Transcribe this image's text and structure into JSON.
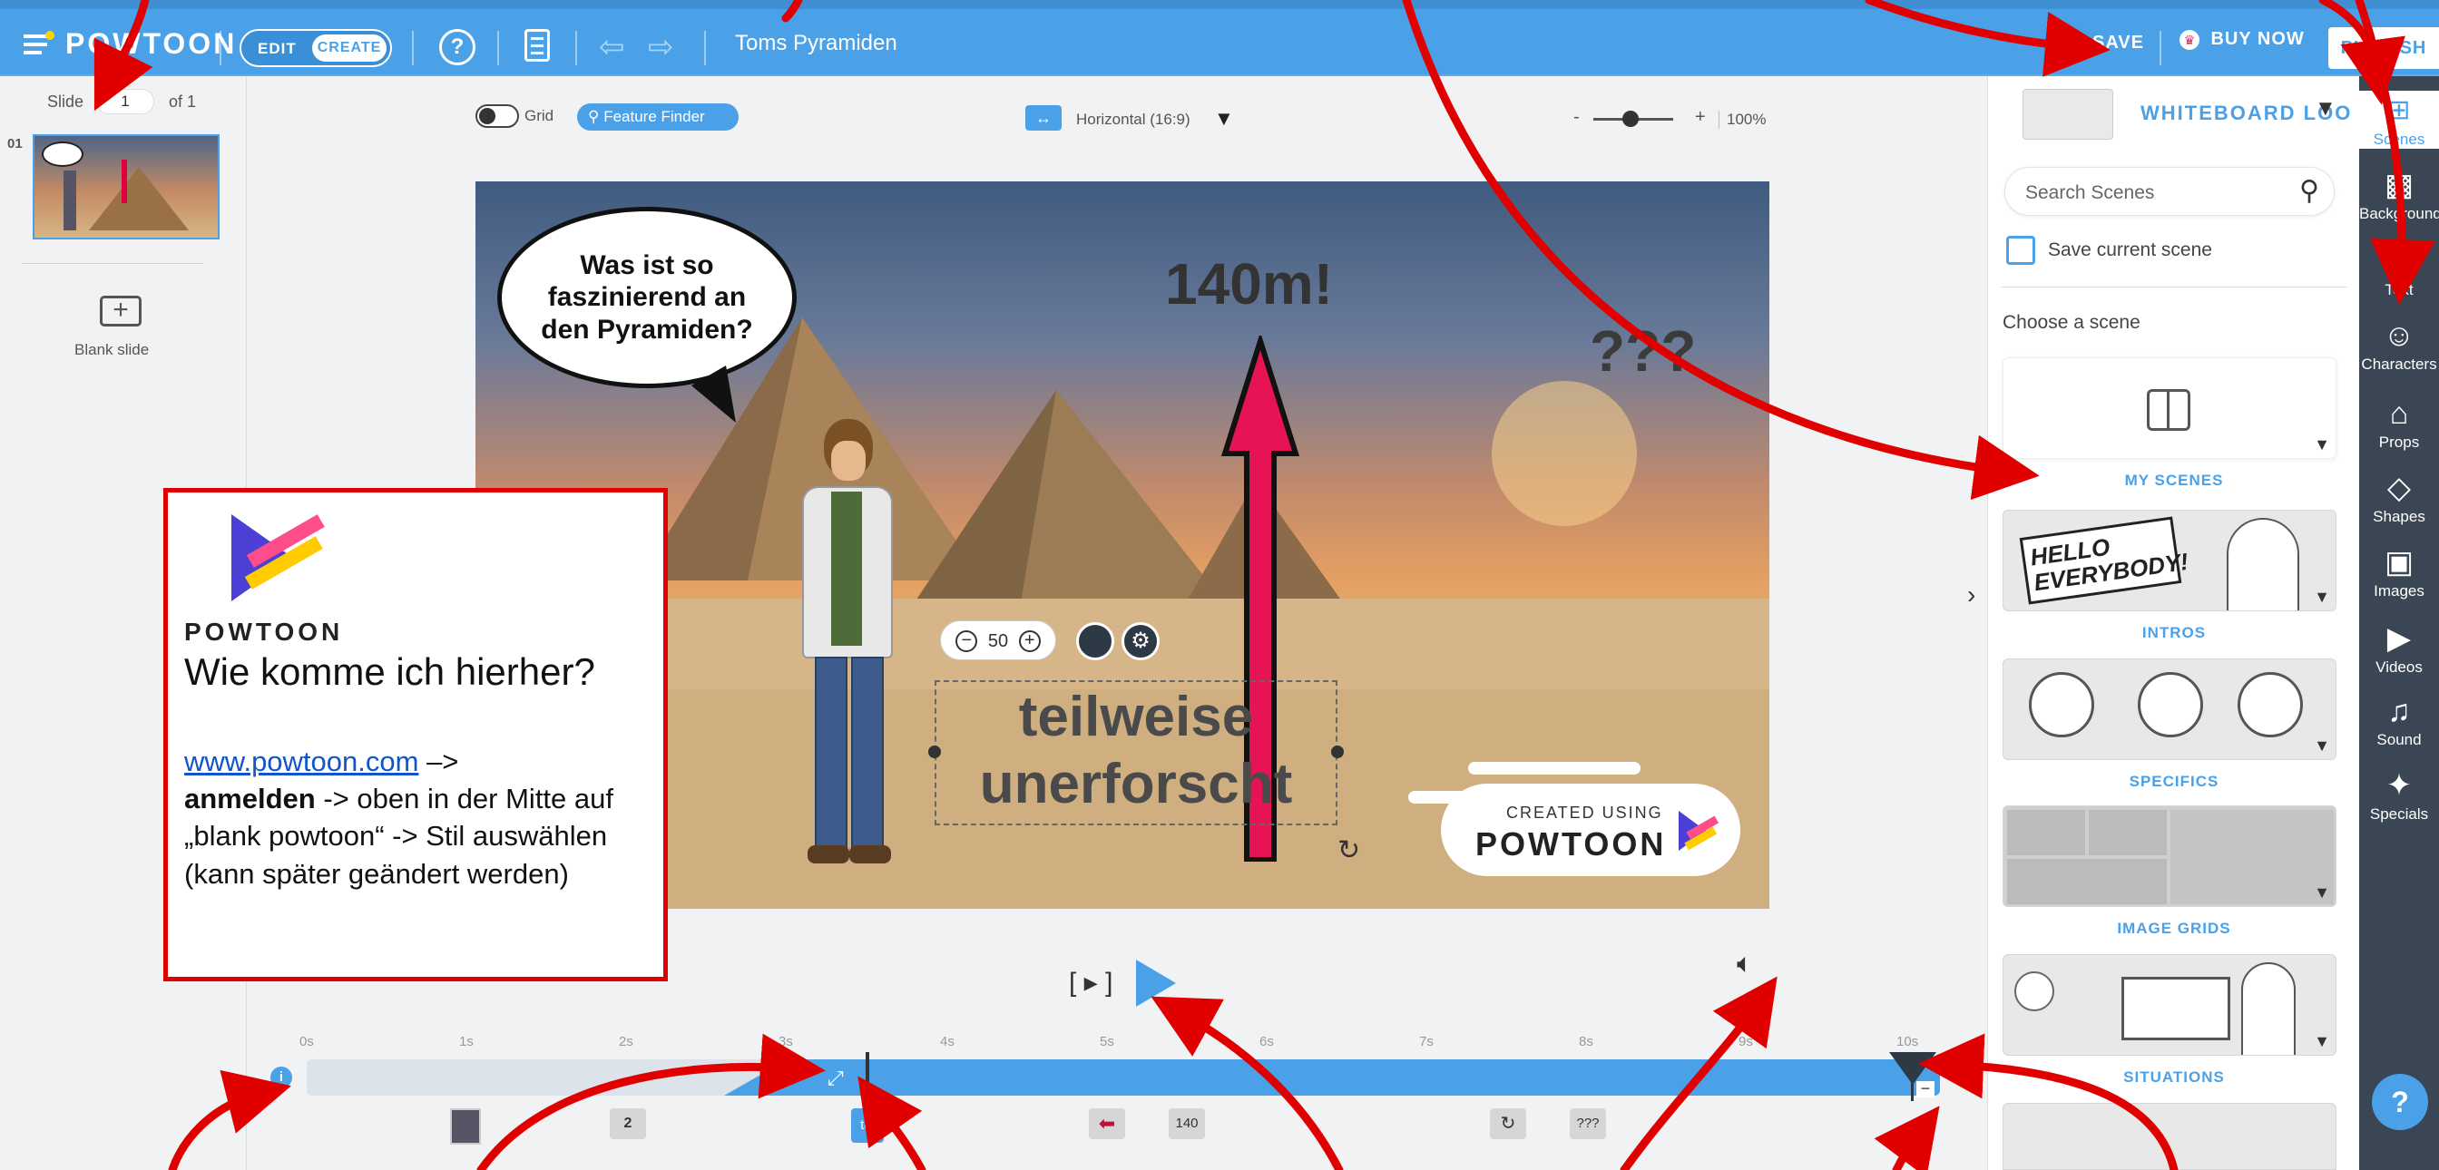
{
  "app": {
    "logo_text": "POWTOON",
    "mode_edit": "EDIT",
    "mode_create": "CREATE",
    "help_symbol": "?",
    "project_title": "Toms Pyramiden",
    "save_label": "SAVE",
    "buy_label": "BUY NOW",
    "publish_label": "PUBLISH"
  },
  "slides": {
    "label": "Slide",
    "current": "1",
    "of_label": "of 1",
    "items": [
      {
        "number": "01"
      }
    ],
    "blank_label": "Blank slide"
  },
  "canvas_toolbar": {
    "grid_label": "Grid",
    "feature_finder_label": "Feature Finder",
    "orientation_label": "Horizontal (16:9)",
    "zoom_minus": "-",
    "zoom_plus": "+",
    "zoom_value": "100%"
  },
  "stage": {
    "speech_bubble": "Was ist so faszinierend an den Pyramiden?",
    "height_text": "140m!",
    "question_text": "???",
    "text_box_line1": "teilweise",
    "text_box_line2": "unerforscht",
    "size_value": "50",
    "watermark_top": "CREATED USING",
    "watermark_brand": "POWTOON"
  },
  "info_box": {
    "brand": "POWTOON",
    "heading": "Wie komme ich hierher?",
    "link": "www.powtoon.com",
    "arrow_text": " –>",
    "bold_word": "anmelden",
    "rest_text": " -> oben in der Mitte auf „blank powtoon“ -> Stil auswählen (kann später geändert werden)"
  },
  "playback": {
    "preview_label": "[ ▸ ]",
    "ticks": [
      "0s",
      "1s",
      "2s",
      "3s",
      "4s",
      "5s",
      "6s",
      "7s",
      "8s",
      "9s",
      "10s"
    ],
    "info_symbol": "i",
    "track_items": [
      {
        "label": "2"
      },
      {
        "label": "tei"
      },
      {
        "label": "140"
      },
      {
        "label": "???"
      }
    ]
  },
  "right_panel": {
    "style_title": "WHITEBOARD LOO",
    "search_placeholder": "Search Scenes",
    "save_scene_label": "Save current scene",
    "choose_label": "Choose a scene",
    "categories": [
      {
        "label": "MY SCENES"
      },
      {
        "label": "INTROS",
        "art_text": "HELLO EVERYBODY!"
      },
      {
        "label": "SPECIFICS"
      },
      {
        "label": "IMAGE GRIDS"
      },
      {
        "label": "SITUATIONS"
      }
    ]
  },
  "tools": [
    {
      "label": "Scenes",
      "icon": "scenes-icon"
    },
    {
      "label": "Background",
      "icon": "background-icon"
    },
    {
      "label": "Text",
      "icon": "text-icon"
    },
    {
      "label": "Characters",
      "icon": "characters-icon"
    },
    {
      "label": "Props",
      "icon": "props-icon"
    },
    {
      "label": "Shapes",
      "icon": "shapes-icon"
    },
    {
      "label": "Images",
      "icon": "images-icon"
    },
    {
      "label": "Videos",
      "icon": "videos-icon"
    },
    {
      "label": "Sound",
      "icon": "sound-icon"
    },
    {
      "label": "Specials",
      "icon": "specials-icon"
    }
  ],
  "help_bubble": "?",
  "colors": {
    "accent": "#4aa1e8",
    "annotation_red": "#e00000",
    "toolbar_dark": "#3a4654"
  }
}
